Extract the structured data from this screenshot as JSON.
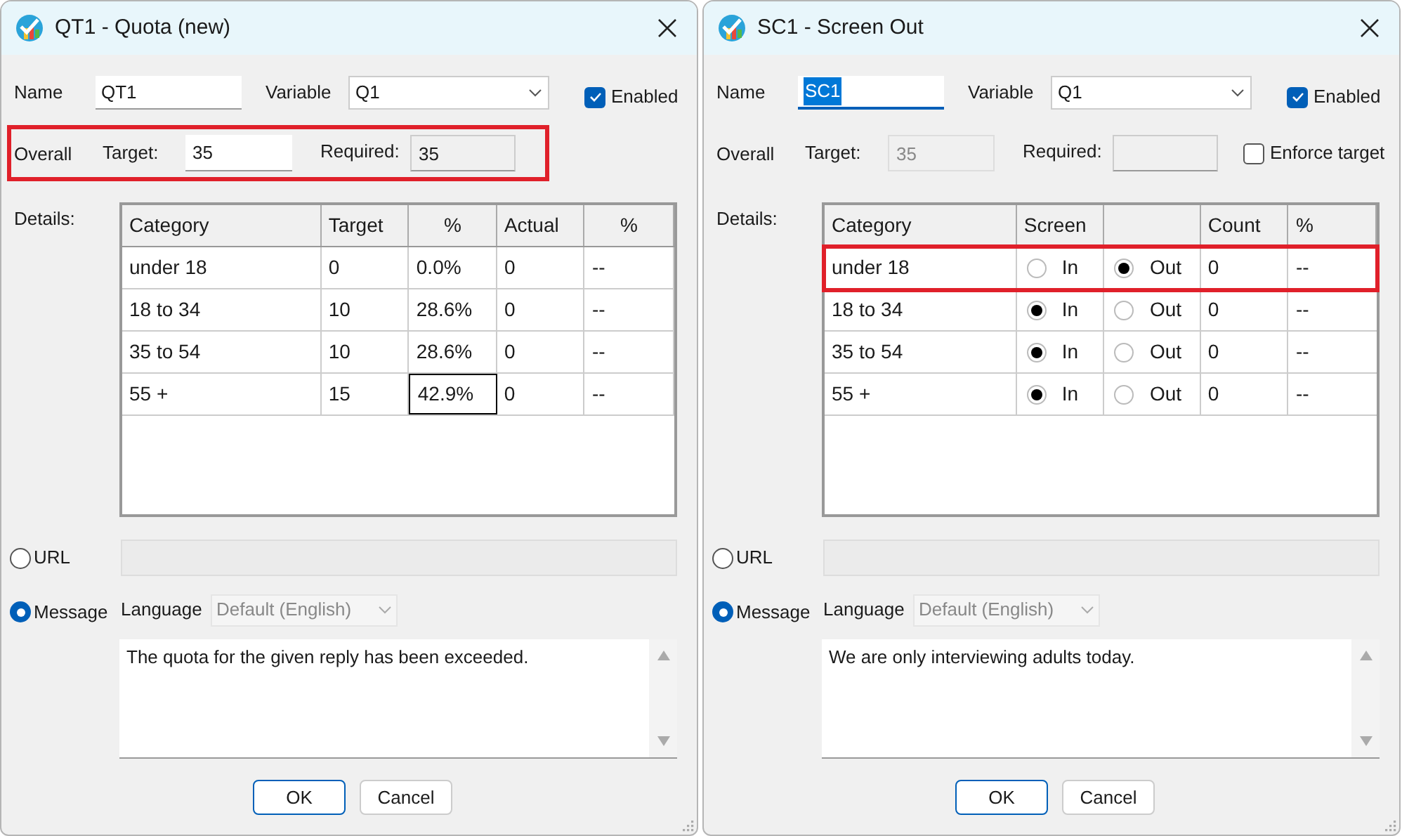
{
  "dialogs": [
    {
      "kind": "quota",
      "title": "QT1 - Quota (new)",
      "name": {
        "label": "Name",
        "value": "QT1",
        "text_selected": false
      },
      "variable": {
        "label": "Variable",
        "value": "Q1"
      },
      "enabled": {
        "label": "Enabled",
        "checked": true
      },
      "overall": {
        "label": "Overall",
        "highlighted": true,
        "target_label": "Target:",
        "target_value": "35",
        "target_disabled": false,
        "required_label": "Required:",
        "required_value": "35"
      },
      "details_label": "Details:",
      "table": {
        "columns": [
          "Category",
          "Target",
          "%",
          "Actual",
          "%"
        ],
        "rows": [
          {
            "highlighted": false,
            "cells": [
              {
                "text": "under 18",
                "focused": false
              },
              {
                "text": "0",
                "focused": false
              },
              {
                "text": "0.0%",
                "focused": false
              },
              {
                "text": "0",
                "focused": false
              },
              {
                "text": "--",
                "focused": false
              }
            ]
          },
          {
            "highlighted": false,
            "cells": [
              {
                "text": "18 to 34",
                "focused": false
              },
              {
                "text": "10",
                "focused": false
              },
              {
                "text": "28.6%",
                "focused": false
              },
              {
                "text": "0",
                "focused": false
              },
              {
                "text": "--",
                "focused": false
              }
            ]
          },
          {
            "highlighted": false,
            "cells": [
              {
                "text": "35 to 54",
                "focused": false
              },
              {
                "text": "10",
                "focused": false
              },
              {
                "text": "28.6%",
                "focused": false
              },
              {
                "text": "0",
                "focused": false
              },
              {
                "text": "--",
                "focused": false
              }
            ]
          },
          {
            "highlighted": false,
            "cells": [
              {
                "text": "55 +",
                "focused": false
              },
              {
                "text": "15",
                "focused": false
              },
              {
                "text": "42.9%",
                "focused": true
              },
              {
                "text": "0",
                "focused": false
              },
              {
                "text": "--",
                "focused": false
              }
            ]
          }
        ]
      },
      "url": {
        "label": "URL",
        "selected": false
      },
      "message": {
        "label": "Message",
        "selected": true
      },
      "language": {
        "label": "Language",
        "value": "Default (English)"
      },
      "message_text": "The quota for the given reply has been exceeded.",
      "buttons": [
        "OK",
        "Cancel"
      ]
    },
    {
      "kind": "screen",
      "title": "SC1 - Screen Out",
      "name": {
        "label": "Name",
        "value": "SC1",
        "text_selected": true
      },
      "variable": {
        "label": "Variable",
        "value": "Q1"
      },
      "enabled": {
        "label": "Enabled",
        "checked": true
      },
      "overall": {
        "label": "Overall",
        "highlighted": false,
        "target_label": "Target:",
        "target_value": "35",
        "target_disabled": true,
        "required_label": "Required:"
      },
      "enforce": {
        "label": "Enforce target",
        "checked": false
      },
      "details_label": "Details:",
      "table": {
        "columns": [
          "Category",
          "Screen",
          "Count",
          "%"
        ],
        "rows": [
          {
            "highlighted": true,
            "category": "under 18",
            "in": {
              "label": "In",
              "selected": false
            },
            "out": {
              "label": "Out",
              "selected": true
            },
            "count": "0",
            "percent": "--"
          },
          {
            "highlighted": false,
            "category": "18 to 34",
            "in": {
              "label": "In",
              "selected": true
            },
            "out": {
              "label": "Out",
              "selected": false
            },
            "count": "0",
            "percent": "--"
          },
          {
            "highlighted": false,
            "category": "35 to 54",
            "in": {
              "label": "In",
              "selected": true
            },
            "out": {
              "label": "Out",
              "selected": false
            },
            "count": "0",
            "percent": "--"
          },
          {
            "highlighted": false,
            "category": "55 +",
            "in": {
              "label": "In",
              "selected": true
            },
            "out": {
              "label": "Out",
              "selected": false
            },
            "count": "0",
            "percent": "--"
          }
        ]
      },
      "url": {
        "label": "URL",
        "selected": false
      },
      "message": {
        "label": "Message",
        "selected": true
      },
      "language": {
        "label": "Language",
        "value": "Default (English)"
      },
      "message_text": "We are only interviewing adults today.",
      "buttons": [
        "OK",
        "Cancel"
      ]
    }
  ]
}
